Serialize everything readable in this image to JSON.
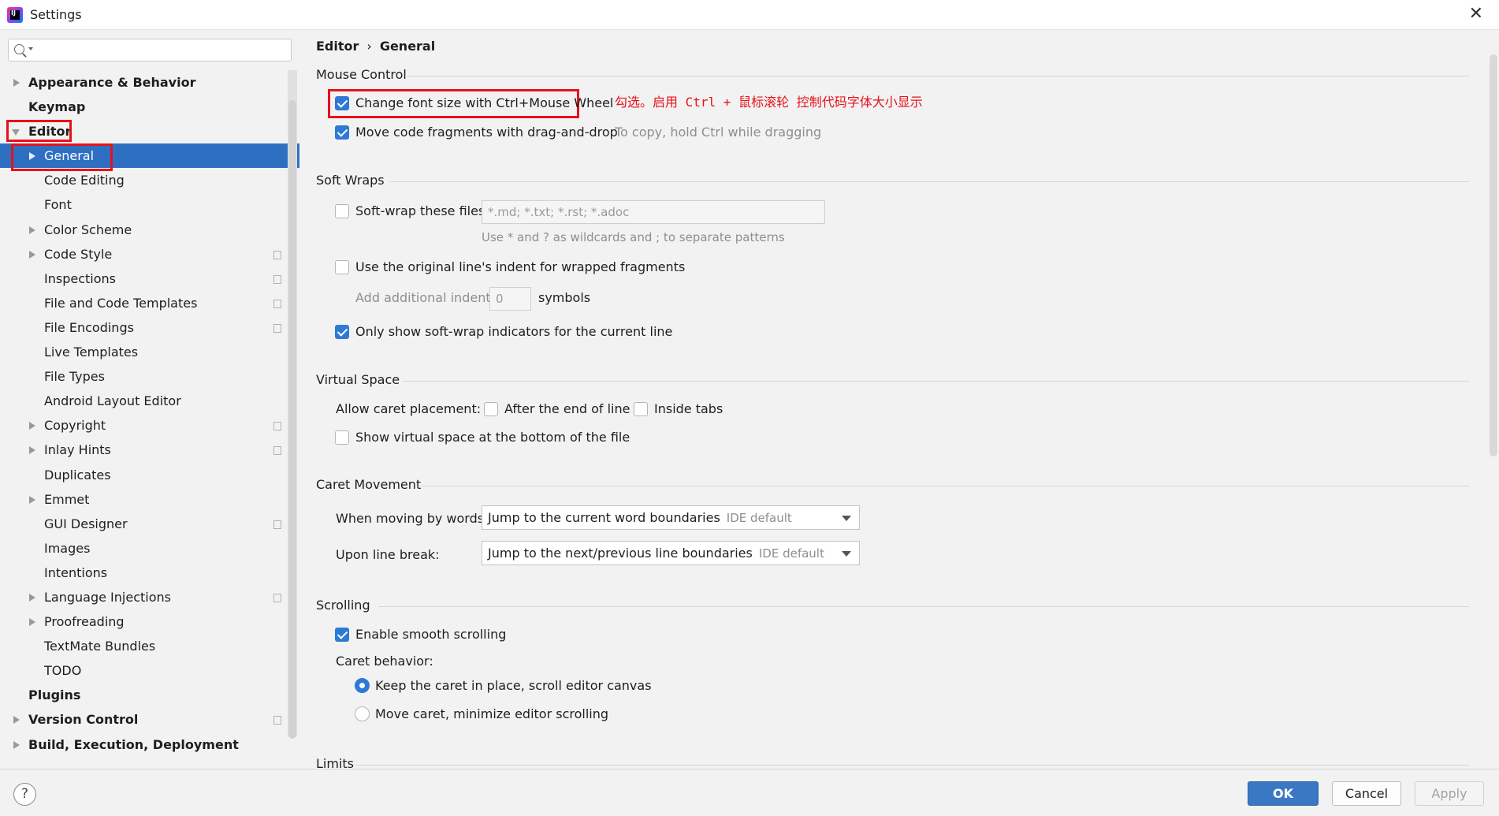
{
  "window": {
    "title": "Settings",
    "close_glyph": "✕"
  },
  "search": {
    "placeholder": ""
  },
  "tree": [
    {
      "label": "Appearance & Behavior",
      "bold": true,
      "level": 0,
      "arrow": "right",
      "copy": false
    },
    {
      "label": "Keymap",
      "bold": true,
      "level": 0,
      "arrow": "none",
      "copy": false
    },
    {
      "label": "Editor",
      "bold": true,
      "level": 0,
      "arrow": "down",
      "copy": false
    },
    {
      "label": "General",
      "bold": false,
      "level": 1,
      "arrow": "right",
      "copy": false,
      "selected": true
    },
    {
      "label": "Code Editing",
      "bold": false,
      "level": 1,
      "arrow": "none",
      "copy": false
    },
    {
      "label": "Font",
      "bold": false,
      "level": 1,
      "arrow": "none",
      "copy": false
    },
    {
      "label": "Color Scheme",
      "bold": false,
      "level": 1,
      "arrow": "right",
      "copy": false
    },
    {
      "label": "Code Style",
      "bold": false,
      "level": 1,
      "arrow": "right",
      "copy": true
    },
    {
      "label": "Inspections",
      "bold": false,
      "level": 1,
      "arrow": "none",
      "copy": true
    },
    {
      "label": "File and Code Templates",
      "bold": false,
      "level": 1,
      "arrow": "none",
      "copy": true
    },
    {
      "label": "File Encodings",
      "bold": false,
      "level": 1,
      "arrow": "none",
      "copy": true
    },
    {
      "label": "Live Templates",
      "bold": false,
      "level": 1,
      "arrow": "none",
      "copy": false
    },
    {
      "label": "File Types",
      "bold": false,
      "level": 1,
      "arrow": "none",
      "copy": false
    },
    {
      "label": "Android Layout Editor",
      "bold": false,
      "level": 1,
      "arrow": "none",
      "copy": false
    },
    {
      "label": "Copyright",
      "bold": false,
      "level": 1,
      "arrow": "right",
      "copy": true
    },
    {
      "label": "Inlay Hints",
      "bold": false,
      "level": 1,
      "arrow": "right",
      "copy": true
    },
    {
      "label": "Duplicates",
      "bold": false,
      "level": 1,
      "arrow": "none",
      "copy": false
    },
    {
      "label": "Emmet",
      "bold": false,
      "level": 1,
      "arrow": "right",
      "copy": false
    },
    {
      "label": "GUI Designer",
      "bold": false,
      "level": 1,
      "arrow": "none",
      "copy": true
    },
    {
      "label": "Images",
      "bold": false,
      "level": 1,
      "arrow": "none",
      "copy": false
    },
    {
      "label": "Intentions",
      "bold": false,
      "level": 1,
      "arrow": "none",
      "copy": false
    },
    {
      "label": "Language Injections",
      "bold": false,
      "level": 1,
      "arrow": "right",
      "copy": true
    },
    {
      "label": "Proofreading",
      "bold": false,
      "level": 1,
      "arrow": "right",
      "copy": false
    },
    {
      "label": "TextMate Bundles",
      "bold": false,
      "level": 1,
      "arrow": "none",
      "copy": false
    },
    {
      "label": "TODO",
      "bold": false,
      "level": 1,
      "arrow": "none",
      "copy": false
    },
    {
      "label": "Plugins",
      "bold": true,
      "level": 0,
      "arrow": "none",
      "copy": false
    },
    {
      "label": "Version Control",
      "bold": true,
      "level": 0,
      "arrow": "right",
      "copy": true
    },
    {
      "label": "Build, Execution, Deployment",
      "bold": true,
      "level": 0,
      "arrow": "right",
      "copy": false
    }
  ],
  "breadcrumb": {
    "root": "Editor",
    "sep": "›",
    "current": "General"
  },
  "sections": {
    "mouse_control": "Mouse Control",
    "soft_wraps": "Soft Wraps",
    "virtual_space": "Virtual Space",
    "caret_movement": "Caret Movement",
    "scrolling": "Scrolling",
    "limits": "Limits"
  },
  "options": {
    "change_font_size": {
      "label": "Change font size with Ctrl+Mouse Wheel",
      "checked": true
    },
    "annotation": "勾选。启用 Ctrl + 鼠标滚轮 控制代码字体大小显示",
    "move_code": {
      "label": "Move code fragments with drag-and-drop",
      "checked": true
    },
    "move_code_hint": "To copy, hold Ctrl while dragging",
    "soft_wrap_files": {
      "label": "Soft-wrap these files:",
      "checked": false
    },
    "soft_wrap_patterns": "*.md; *.txt; *.rst; *.adoc",
    "soft_wrap_help": "Use * and ? as wildcards and ; to separate patterns",
    "original_indent": {
      "label": "Use the original line's indent for wrapped fragments",
      "checked": false
    },
    "additional_indent_label": "Add additional indent:",
    "additional_indent_value": "0",
    "symbols": "symbols",
    "only_show_indicators": {
      "label": "Only show soft-wrap indicators for the current line",
      "checked": true
    },
    "allow_caret_label": "Allow caret placement:",
    "after_end_of_line": {
      "label": "After the end of line",
      "checked": false
    },
    "inside_tabs": {
      "label": "Inside tabs",
      "checked": false
    },
    "show_virtual_space": {
      "label": "Show virtual space at the bottom of the file",
      "checked": false
    },
    "moving_by_words_label": "When moving by words:",
    "moving_by_words_value": "Jump to the current word boundaries",
    "moving_by_words_hint": "IDE default",
    "line_break_label": "Upon line break:",
    "line_break_value": "Jump to the next/previous line boundaries",
    "line_break_hint": "IDE default",
    "smooth_scrolling": {
      "label": "Enable smooth scrolling",
      "checked": true
    },
    "caret_behavior_label": "Caret behavior:",
    "keep_caret": {
      "label": "Keep the caret in place, scroll editor canvas",
      "selected": true
    },
    "move_caret": {
      "label": "Move caret, minimize editor scrolling",
      "selected": false
    }
  },
  "footer": {
    "help": "?",
    "ok": "OK",
    "cancel": "Cancel",
    "apply": "Apply"
  },
  "colors": {
    "selection": "#2f6fc2",
    "checkbox": "#2d7ad6",
    "annotation_red": "#e8111a",
    "primary_button": "#3b78c4"
  }
}
